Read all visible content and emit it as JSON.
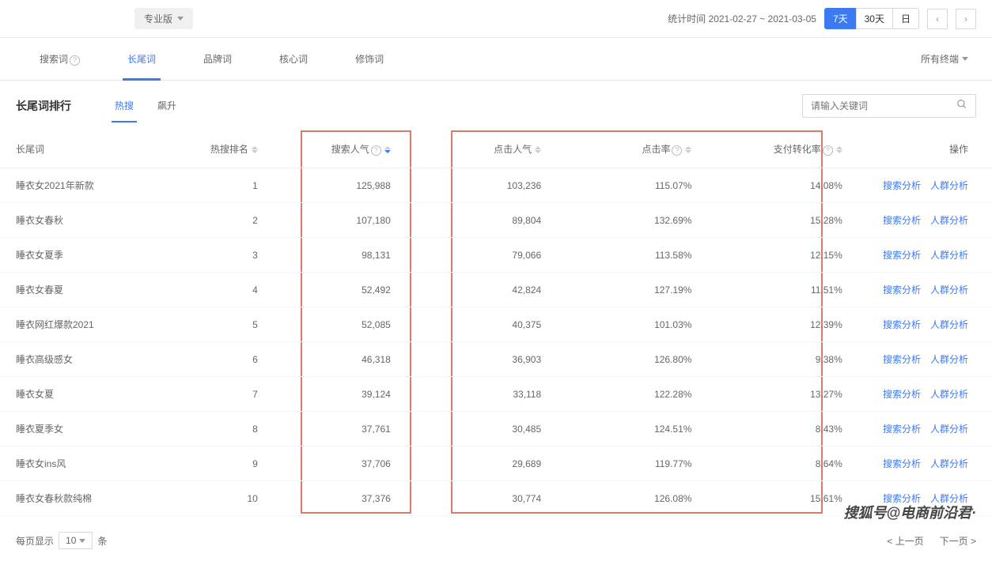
{
  "topbar": {
    "version": "专业版",
    "date_label": "统计时间 2021-02-27 ~ 2021-03-05",
    "btn_7d": "7天",
    "btn_30d": "30天",
    "btn_day": "日"
  },
  "nav": {
    "tabs": [
      "搜索词",
      "长尾词",
      "品牌词",
      "核心词",
      "修饰词"
    ],
    "terminal": "所有终端"
  },
  "section": {
    "title": "长尾词排行",
    "subtab_hot": "热搜",
    "subtab_rise": "飙升",
    "search_placeholder": "请输入关键词"
  },
  "table": {
    "headers": {
      "word": "长尾词",
      "rank": "热搜排名",
      "pop": "搜索人气",
      "click": "点击人气",
      "rate": "点击率",
      "conv": "支付转化率",
      "action": "操作"
    },
    "action_search": "搜索分析",
    "action_crowd": "人群分析",
    "rows": [
      {
        "word": "睡衣女2021年新款",
        "rank": "1",
        "pop": "125,988",
        "click": "103,236",
        "rate": "115.07%",
        "conv": "14.08%"
      },
      {
        "word": "睡衣女春秋",
        "rank": "2",
        "pop": "107,180",
        "click": "89,804",
        "rate": "132.69%",
        "conv": "15.28%"
      },
      {
        "word": "睡衣女夏季",
        "rank": "3",
        "pop": "98,131",
        "click": "79,066",
        "rate": "113.58%",
        "conv": "12.15%"
      },
      {
        "word": "睡衣女春夏",
        "rank": "4",
        "pop": "52,492",
        "click": "42,824",
        "rate": "127.19%",
        "conv": "11.51%"
      },
      {
        "word": "睡衣网红爆款2021",
        "rank": "5",
        "pop": "52,085",
        "click": "40,375",
        "rate": "101.03%",
        "conv": "12.39%"
      },
      {
        "word": "睡衣高级感女",
        "rank": "6",
        "pop": "46,318",
        "click": "36,903",
        "rate": "126.80%",
        "conv": "9.38%"
      },
      {
        "word": "睡衣女夏",
        "rank": "7",
        "pop": "39,124",
        "click": "33,118",
        "rate": "122.28%",
        "conv": "13.27%"
      },
      {
        "word": "睡衣夏季女",
        "rank": "8",
        "pop": "37,761",
        "click": "30,485",
        "rate": "124.51%",
        "conv": "8.43%"
      },
      {
        "word": "睡衣女ins风",
        "rank": "9",
        "pop": "37,706",
        "click": "29,689",
        "rate": "119.77%",
        "conv": "8.64%"
      },
      {
        "word": "睡衣女春秋款纯棉",
        "rank": "10",
        "pop": "37,376",
        "click": "30,774",
        "rate": "126.08%",
        "conv": "15.61%"
      }
    ]
  },
  "pagination": {
    "per_page_label": "每页显示",
    "per_page_value": "10",
    "per_page_suffix": "条",
    "prev": "< 上一页",
    "next": "下一页 >"
  },
  "watermark": "搜狐号@电商前沿君·"
}
